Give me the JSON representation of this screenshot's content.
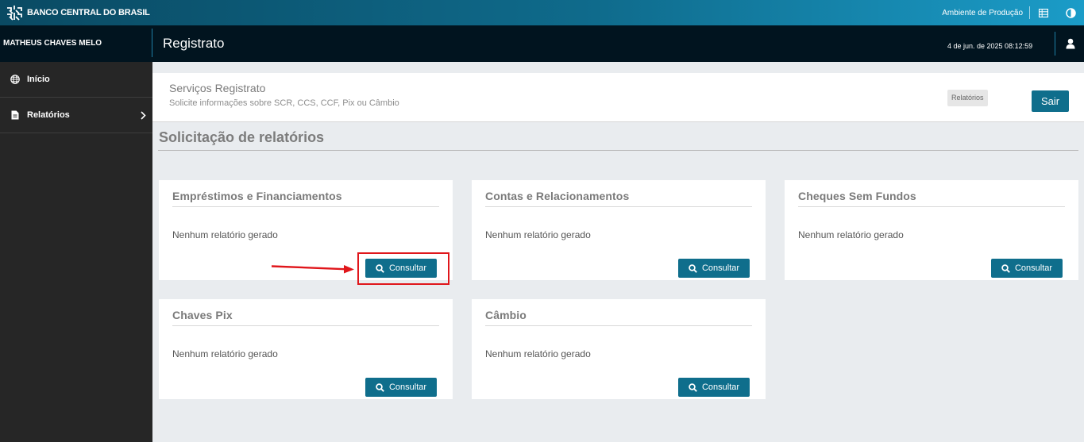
{
  "topbar": {
    "brand": "BANCO CENTRAL DO BRASIL",
    "environment": "Ambiente de Produção",
    "icons": [
      "table-icon",
      "contrast-icon"
    ]
  },
  "header": {
    "user_name": "MATHEUS CHAVES MELO",
    "app_title": "Registrato",
    "timestamp": "4 de jun. de 2025 08:12:59",
    "user_icon": "user-icon"
  },
  "sidebar": {
    "items": [
      {
        "label": "Início",
        "icon": "globe-icon"
      },
      {
        "label": "Relatórios",
        "icon": "document-icon"
      }
    ]
  },
  "service": {
    "title": "Serviços Registrato",
    "subtitle": "Solicite informações sobre SCR, CCS, CCF, Pix ou Câmbio",
    "tag": "Relatórios",
    "exit_label": "Sair"
  },
  "section": {
    "title": "Solicitação de relatórios"
  },
  "cards": [
    {
      "title": "Empréstimos e Financiamentos",
      "status": "Nenhum relatório gerado",
      "button": "Consultar"
    },
    {
      "title": "Contas e Relacionamentos",
      "status": "Nenhum relatório gerado",
      "button": "Consultar"
    },
    {
      "title": "Cheques Sem Fundos",
      "status": "Nenhum relatório gerado",
      "button": "Consultar"
    },
    {
      "title": "Chaves Pix",
      "status": "Nenhum relatório gerado",
      "button": "Consultar"
    },
    {
      "title": "Câmbio",
      "status": "Nenhum relatório gerado",
      "button": "Consultar"
    }
  ],
  "colors": {
    "primary": "#0f6e8c",
    "header": "#01141f",
    "sidebar": "#262626",
    "annotation": "#e0161b"
  }
}
